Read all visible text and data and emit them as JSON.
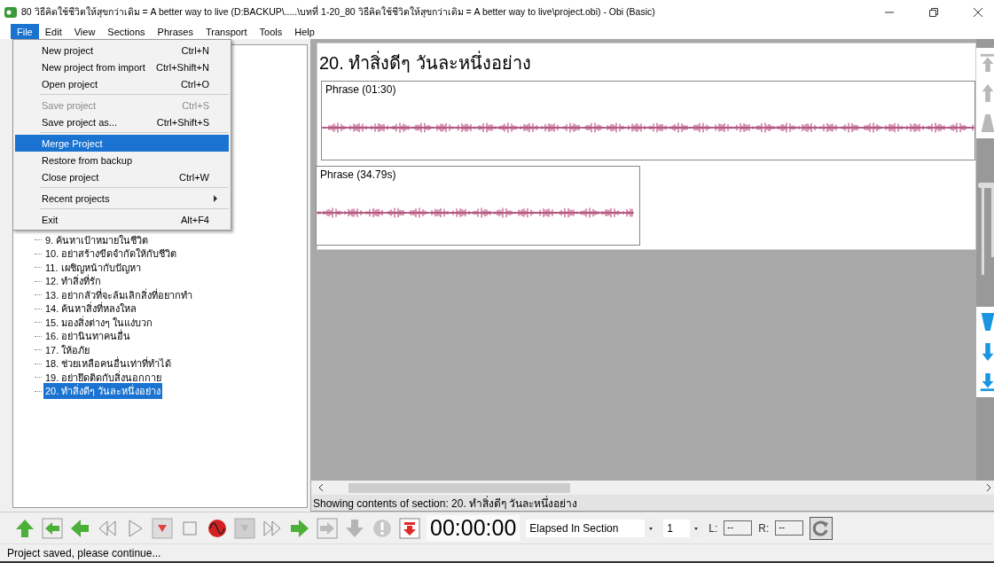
{
  "window": {
    "title": "80 วิธีคิดใช้ชีวิตให้สุขกว่าเดิม = A better way to live (D:BACKUP\\.....\\บทที่ 1-20_80 วิธีคิดใช้ชีวิตให้สุขกว่าเดิม = A better way to live\\project.obi) - Obi (Basic)"
  },
  "menubar": [
    {
      "label": "File",
      "selected": true
    },
    {
      "label": "Edit",
      "selected": false
    },
    {
      "label": "View",
      "selected": false
    },
    {
      "label": "Sections",
      "selected": false
    },
    {
      "label": "Phrases",
      "selected": false
    },
    {
      "label": "Transport",
      "selected": false
    },
    {
      "label": "Tools",
      "selected": false
    },
    {
      "label": "Help",
      "selected": false
    }
  ],
  "file_menu": [
    {
      "kind": "item",
      "label": "New project",
      "shortcut": "Ctrl+N",
      "disabled": false,
      "selected": false
    },
    {
      "kind": "item",
      "label": "New project from import",
      "shortcut": "Ctrl+Shift+N",
      "disabled": false,
      "selected": false
    },
    {
      "kind": "item",
      "label": "Open project",
      "shortcut": "Ctrl+O",
      "disabled": false,
      "selected": false
    },
    {
      "kind": "separator"
    },
    {
      "kind": "item",
      "label": "Save project",
      "shortcut": "Ctrl+S",
      "disabled": true,
      "selected": false
    },
    {
      "kind": "item",
      "label": "Save project as...",
      "shortcut": "Ctrl+Shift+S",
      "disabled": false,
      "selected": false
    },
    {
      "kind": "separator"
    },
    {
      "kind": "item",
      "label": "Merge Project",
      "disabled": false,
      "selected": true
    },
    {
      "kind": "item",
      "label": "Restore from backup",
      "disabled": false,
      "selected": false
    },
    {
      "kind": "item",
      "label": "Close project",
      "shortcut": "Ctrl+W",
      "disabled": false,
      "selected": false
    },
    {
      "kind": "separator"
    },
    {
      "kind": "submenu",
      "label": "Recent projects",
      "disabled": false,
      "selected": false
    },
    {
      "kind": "separator"
    },
    {
      "kind": "item",
      "label": "Exit",
      "shortcut": "Alt+F4",
      "disabled": false,
      "selected": false
    }
  ],
  "tree": [
    {
      "label": "9. ค้นหาเป้าหมายในชีวิต",
      "selected": false
    },
    {
      "label": "10. อย่าสร้างขีดจำกัดให้กับชีวิต",
      "selected": false
    },
    {
      "label": "11. เผชิญหน้ากับปัญหา",
      "selected": false
    },
    {
      "label": "12. ทำสิ่งที่รัก",
      "selected": false
    },
    {
      "label": "13. อย่ากลัวที่จะล้มเลิกสิ่งที่อยากทำ",
      "selected": false
    },
    {
      "label": "14. ค้นหาสิ่งที่หลงใหล",
      "selected": false
    },
    {
      "label": "15. มองสิ่งต่างๆ ในแง่บวก",
      "selected": false
    },
    {
      "label": "16. อย่านินทาคนอื่น",
      "selected": false
    },
    {
      "label": "17. ให้อภัย",
      "selected": false
    },
    {
      "label": "18. ช่วยเหลือคนอื่นเท่าที่ทำได้",
      "selected": false
    },
    {
      "label": "19. อย่ายึดติดกับสิ่งนอกกาย",
      "selected": false
    },
    {
      "label": "20. ทำสิ่งดีๆ วันละหนึ่งอย่าง",
      "selected": true
    }
  ],
  "section": {
    "title": "20. ทำสิ่งดีๆ วันละหนึ่งอย่าง",
    "phrases": [
      {
        "label": "Phrase (01:30)"
      },
      {
        "label": "Phrase (34.79s)"
      }
    ]
  },
  "side_toolbar": [
    {
      "kind": "top",
      "disabled": true
    },
    {
      "kind": "up",
      "disabled": true
    },
    {
      "kind": "wedge-up",
      "disabled": true
    },
    {
      "kind": "wedge-down",
      "disabled": false
    },
    {
      "kind": "down",
      "disabled": false
    },
    {
      "kind": "bottom",
      "disabled": false
    }
  ],
  "section_status": "Showing contents of section:  20. ทำสิ่งดีๆ วันละหนึ่งอย่าง",
  "toolbar": [
    {
      "kind": "arrow-up",
      "disabled": false
    },
    {
      "kind": "box-left",
      "disabled": false
    },
    {
      "kind": "arrow-left",
      "disabled": false
    },
    {
      "kind": "rewind",
      "disabled": false
    },
    {
      "kind": "play",
      "disabled": false
    },
    {
      "kind": "record-mark",
      "disabled": false
    },
    {
      "kind": "stop",
      "disabled": false
    },
    {
      "kind": "monitor",
      "disabled": false
    },
    {
      "kind": "record-mark",
      "disabled": true
    },
    {
      "kind": "fast-forward",
      "disabled": false
    },
    {
      "kind": "arrow-right",
      "disabled": false
    },
    {
      "kind": "box-right",
      "disabled": true
    },
    {
      "kind": "arrow-down",
      "disabled": true
    },
    {
      "kind": "alert",
      "disabled": true
    },
    {
      "kind": "arrow-to-bar",
      "disabled": false
    }
  ],
  "time": "00:00:00",
  "time_mode": "Elapsed In Section",
  "step": "1",
  "left_label": "L:",
  "left_value": "--",
  "right_label": "R:",
  "right_value": "--",
  "status_bar": "Project saved, please continue..."
}
